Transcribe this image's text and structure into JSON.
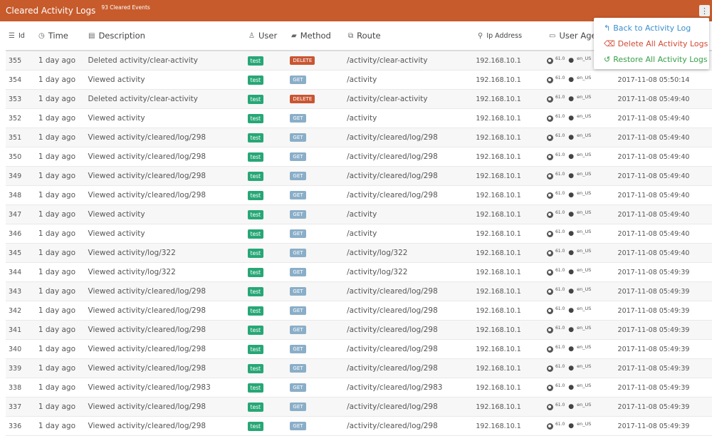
{
  "header": {
    "title": "Cleared Activity Logs",
    "badge": "93 Cleared Events",
    "menu_icon": "⋮"
  },
  "dropdown": {
    "items": [
      {
        "icon": "↰",
        "label": "Back to Activity Log"
      },
      {
        "icon": "⌫",
        "label": "Delete All Activity Logs"
      },
      {
        "icon": "↺",
        "label": "Restore All Activity Logs"
      }
    ]
  },
  "columns": {
    "id": {
      "label": "Id",
      "icon": "☰"
    },
    "time": {
      "label": "Time",
      "icon": "◷"
    },
    "description": {
      "label": "Description",
      "icon": "▤"
    },
    "user": {
      "label": "User",
      "icon": "♙"
    },
    "method": {
      "label": "Method",
      "icon": "▰"
    },
    "route": {
      "label": "Route",
      "icon": "⧉"
    },
    "ip": {
      "label": "Ip Address",
      "icon": "⚲"
    },
    "agent": {
      "label": "User Age",
      "icon": "▭"
    }
  },
  "agent": {
    "version": "61.0",
    "lang": "en_US"
  },
  "colors": {
    "header": "#c75b2c",
    "user_badge": "#27a776",
    "get_badge": "#8aaec8",
    "delete_badge": "#c95532"
  },
  "rows": [
    {
      "id": "355",
      "time": "1 day ago",
      "description": "Deleted activity/clear-activity",
      "user": "test",
      "method": "DELETE",
      "route": "/activity/clear-activity",
      "ip": "192.168.10.1",
      "date": ""
    },
    {
      "id": "354",
      "time": "1 day ago",
      "description": "Viewed activity",
      "user": "test",
      "method": "GET",
      "route": "/activity",
      "ip": "192.168.10.1",
      "date": "2017-11-08 05:50:14"
    },
    {
      "id": "353",
      "time": "1 day ago",
      "description": "Deleted activity/clear-activity",
      "user": "test",
      "method": "DELETE",
      "route": "/activity/clear-activity",
      "ip": "192.168.10.1",
      "date": "2017-11-08 05:49:40"
    },
    {
      "id": "352",
      "time": "1 day ago",
      "description": "Viewed activity",
      "user": "test",
      "method": "GET",
      "route": "/activity",
      "ip": "192.168.10.1",
      "date": "2017-11-08 05:49:40"
    },
    {
      "id": "351",
      "time": "1 day ago",
      "description": "Viewed activity/cleared/log/298",
      "user": "test",
      "method": "GET",
      "route": "/activity/cleared/log/298",
      "ip": "192.168.10.1",
      "date": "2017-11-08 05:49:40"
    },
    {
      "id": "350",
      "time": "1 day ago",
      "description": "Viewed activity/cleared/log/298",
      "user": "test",
      "method": "GET",
      "route": "/activity/cleared/log/298",
      "ip": "192.168.10.1",
      "date": "2017-11-08 05:49:40"
    },
    {
      "id": "349",
      "time": "1 day ago",
      "description": "Viewed activity/cleared/log/298",
      "user": "test",
      "method": "GET",
      "route": "/activity/cleared/log/298",
      "ip": "192.168.10.1",
      "date": "2017-11-08 05:49:40"
    },
    {
      "id": "348",
      "time": "1 day ago",
      "description": "Viewed activity/cleared/log/298",
      "user": "test",
      "method": "GET",
      "route": "/activity/cleared/log/298",
      "ip": "192.168.10.1",
      "date": "2017-11-08 05:49:40"
    },
    {
      "id": "347",
      "time": "1 day ago",
      "description": "Viewed activity",
      "user": "test",
      "method": "GET",
      "route": "/activity",
      "ip": "192.168.10.1",
      "date": "2017-11-08 05:49:40"
    },
    {
      "id": "346",
      "time": "1 day ago",
      "description": "Viewed activity",
      "user": "test",
      "method": "GET",
      "route": "/activity",
      "ip": "192.168.10.1",
      "date": "2017-11-08 05:49:40"
    },
    {
      "id": "345",
      "time": "1 day ago",
      "description": "Viewed activity/log/322",
      "user": "test",
      "method": "GET",
      "route": "/activity/log/322",
      "ip": "192.168.10.1",
      "date": "2017-11-08 05:49:40"
    },
    {
      "id": "344",
      "time": "1 day ago",
      "description": "Viewed activity/log/322",
      "user": "test",
      "method": "GET",
      "route": "/activity/log/322",
      "ip": "192.168.10.1",
      "date": "2017-11-08 05:49:39"
    },
    {
      "id": "343",
      "time": "1 day ago",
      "description": "Viewed activity/cleared/log/298",
      "user": "test",
      "method": "GET",
      "route": "/activity/cleared/log/298",
      "ip": "192.168.10.1",
      "date": "2017-11-08 05:49:39"
    },
    {
      "id": "342",
      "time": "1 day ago",
      "description": "Viewed activity/cleared/log/298",
      "user": "test",
      "method": "GET",
      "route": "/activity/cleared/log/298",
      "ip": "192.168.10.1",
      "date": "2017-11-08 05:49:39"
    },
    {
      "id": "341",
      "time": "1 day ago",
      "description": "Viewed activity/cleared/log/298",
      "user": "test",
      "method": "GET",
      "route": "/activity/cleared/log/298",
      "ip": "192.168.10.1",
      "date": "2017-11-08 05:49:39"
    },
    {
      "id": "340",
      "time": "1 day ago",
      "description": "Viewed activity/cleared/log/298",
      "user": "test",
      "method": "GET",
      "route": "/activity/cleared/log/298",
      "ip": "192.168.10.1",
      "date": "2017-11-08 05:49:39"
    },
    {
      "id": "339",
      "time": "1 day ago",
      "description": "Viewed activity/cleared/log/298",
      "user": "test",
      "method": "GET",
      "route": "/activity/cleared/log/298",
      "ip": "192.168.10.1",
      "date": "2017-11-08 05:49:39"
    },
    {
      "id": "338",
      "time": "1 day ago",
      "description": "Viewed activity/cleared/log/2983",
      "user": "test",
      "method": "GET",
      "route": "/activity/cleared/log/2983",
      "ip": "192.168.10.1",
      "date": "2017-11-08 05:49:39"
    },
    {
      "id": "337",
      "time": "1 day ago",
      "description": "Viewed activity/cleared/log/298",
      "user": "test",
      "method": "GET",
      "route": "/activity/cleared/log/298",
      "ip": "192.168.10.1",
      "date": "2017-11-08 05:49:39"
    },
    {
      "id": "336",
      "time": "1 day ago",
      "description": "Viewed activity/cleared/log/298",
      "user": "test",
      "method": "GET",
      "route": "/activity/cleared/log/298",
      "ip": "192.168.10.1",
      "date": "2017-11-08 05:49:39"
    }
  ]
}
